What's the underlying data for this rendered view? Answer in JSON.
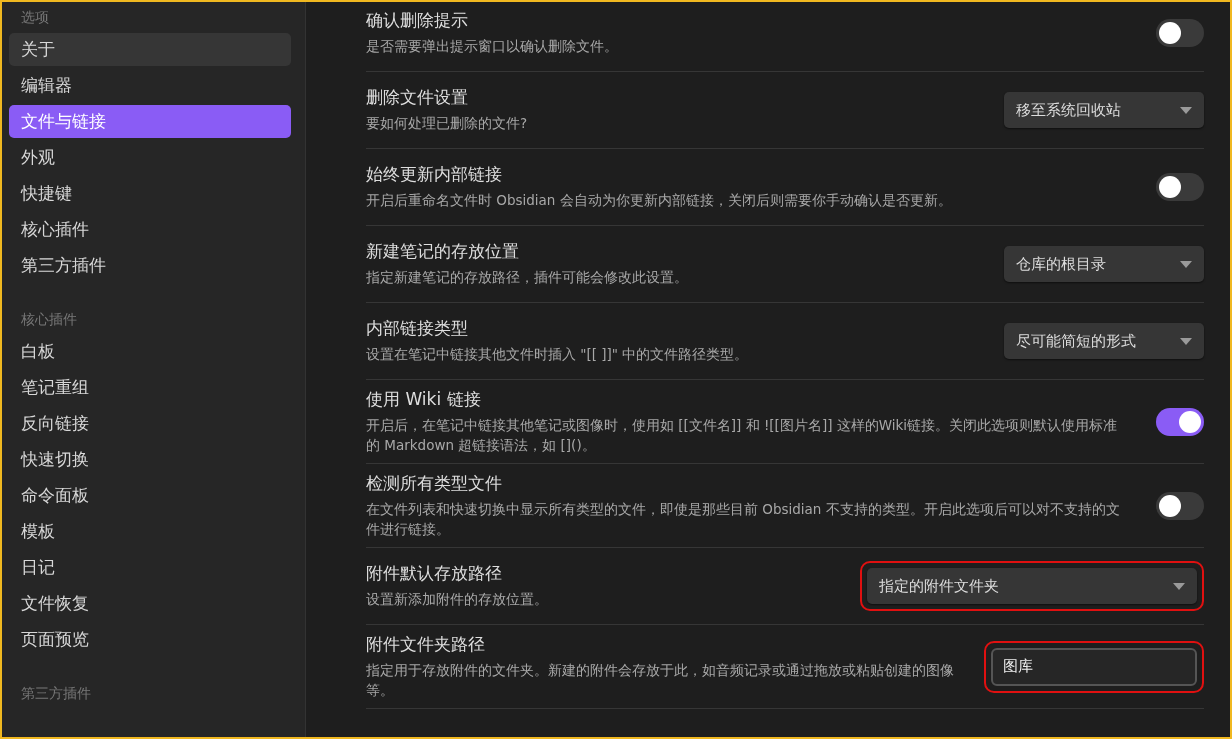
{
  "sidebar": {
    "sections": [
      {
        "heading": "选项",
        "items": [
          {
            "label": "关于",
            "selected": false,
            "hovered": true
          },
          {
            "label": "编辑器",
            "selected": false,
            "hovered": false
          },
          {
            "label": "文件与链接",
            "selected": true,
            "hovered": false
          },
          {
            "label": "外观",
            "selected": false,
            "hovered": false
          },
          {
            "label": "快捷键",
            "selected": false,
            "hovered": false
          },
          {
            "label": "核心插件",
            "selected": false,
            "hovered": false
          },
          {
            "label": "第三方插件",
            "selected": false,
            "hovered": false
          }
        ]
      },
      {
        "heading": "核心插件",
        "items": [
          {
            "label": "白板",
            "selected": false,
            "hovered": false
          },
          {
            "label": "笔记重组",
            "selected": false,
            "hovered": false
          },
          {
            "label": "反向链接",
            "selected": false,
            "hovered": false
          },
          {
            "label": "快速切换",
            "selected": false,
            "hovered": false
          },
          {
            "label": "命令面板",
            "selected": false,
            "hovered": false
          },
          {
            "label": "模板",
            "selected": false,
            "hovered": false
          },
          {
            "label": "日记",
            "selected": false,
            "hovered": false
          },
          {
            "label": "文件恢复",
            "selected": false,
            "hovered": false
          },
          {
            "label": "页面预览",
            "selected": false,
            "hovered": false
          }
        ]
      },
      {
        "heading": "第三方插件"
      }
    ]
  },
  "settings": [
    {
      "kind": "toggle",
      "title": "确认删除提示",
      "description": "是否需要弹出提示窗口以确认删除文件。",
      "on": false
    },
    {
      "kind": "dropdown",
      "title": "删除文件设置",
      "description": "要如何处理已删除的文件?",
      "value": "移至系统回收站",
      "highlighted": false
    },
    {
      "kind": "toggle",
      "title": "始终更新内部链接",
      "description": "开启后重命名文件时 Obsidian 会自动为你更新内部链接，关闭后则需要你手动确认是否更新。",
      "on": false
    },
    {
      "kind": "dropdown",
      "title": "新建笔记的存放位置",
      "description": "指定新建笔记的存放路径，插件可能会修改此设置。",
      "value": "仓库的根目录",
      "highlighted": false
    },
    {
      "kind": "dropdown",
      "title": "内部链接类型",
      "description": "设置在笔记中链接其他文件时插入 \"[[ ]]\" 中的文件路径类型。",
      "value": "尽可能简短的形式",
      "highlighted": false
    },
    {
      "kind": "toggle",
      "title": "使用 Wiki 链接",
      "description": "开启后，在笔记中链接其他笔记或图像时，使用如 [[文件名]] 和 ![[图片名]] 这样的Wiki链接。关闭此选项则默认使用标准的 Markdown 超链接语法，如 []()。",
      "on": true
    },
    {
      "kind": "toggle",
      "title": "检测所有类型文件",
      "description": "在文件列表和快速切换中显示所有类型的文件，即使是那些目前 Obsidian 不支持的类型。开启此选项后可以对不支持的文件进行链接。",
      "on": false
    },
    {
      "kind": "dropdown",
      "title": "附件默认存放路径",
      "description": "设置新添加附件的存放位置。",
      "value": "指定的附件文件夹",
      "highlighted": true
    },
    {
      "kind": "text",
      "title": "附件文件夹路径",
      "description": "指定用于存放附件的文件夹。新建的附件会存放于此，如音频记录或通过拖放或粘贴创建的图像等。",
      "value": "图库",
      "highlighted": true
    }
  ]
}
